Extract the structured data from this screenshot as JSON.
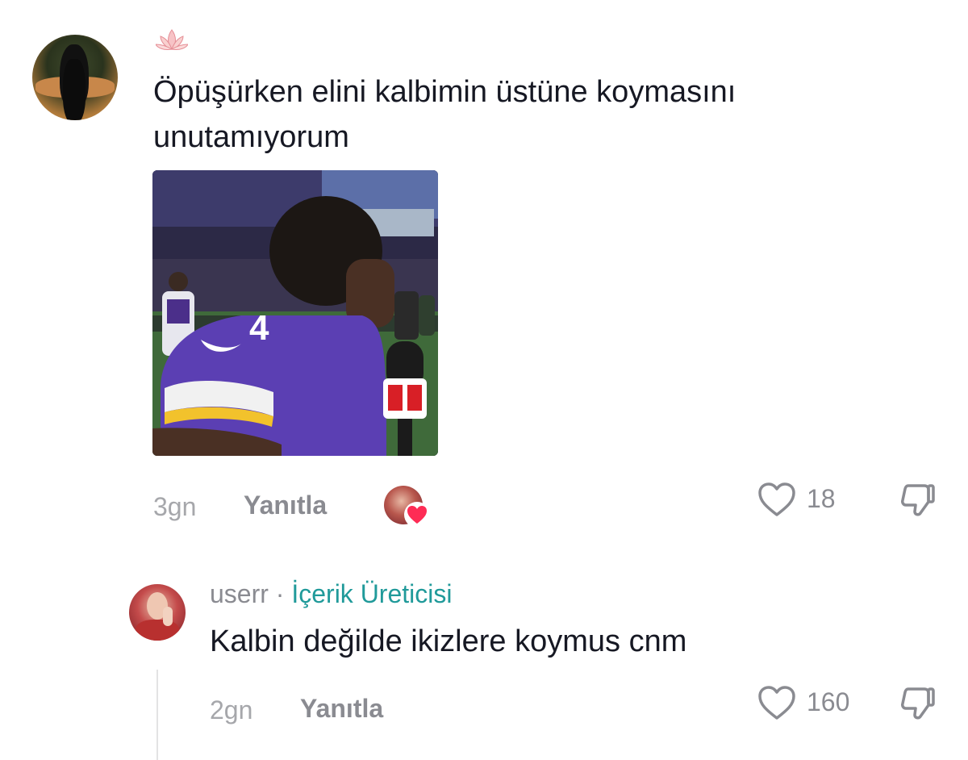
{
  "comment": {
    "text_line1": "Öpüşürken elini kalbimin üstüne koymasını",
    "text_line2": "unutamıyorum",
    "time": "3gn",
    "reply_label": "Yanıtla",
    "like_count": "18",
    "icons": {
      "avatar": "user-avatar",
      "emoji": "lotus-icon",
      "creator_liked": "creator-heart-icon",
      "like": "heart-outline-icon",
      "dislike": "thumbs-down-icon"
    }
  },
  "reply": {
    "username": "userr",
    "separator": "·",
    "badge": "İçerik Üreticisi",
    "text": "Kalbin değilde ikizlere koymus cnm",
    "time": "2gn",
    "reply_label": "Yanıtla",
    "like_count": "160"
  },
  "colors": {
    "text": "#161823",
    "muted": "#8a8b91",
    "creator_badge": "#209a9a",
    "heart_badge": "#fe2c55"
  }
}
